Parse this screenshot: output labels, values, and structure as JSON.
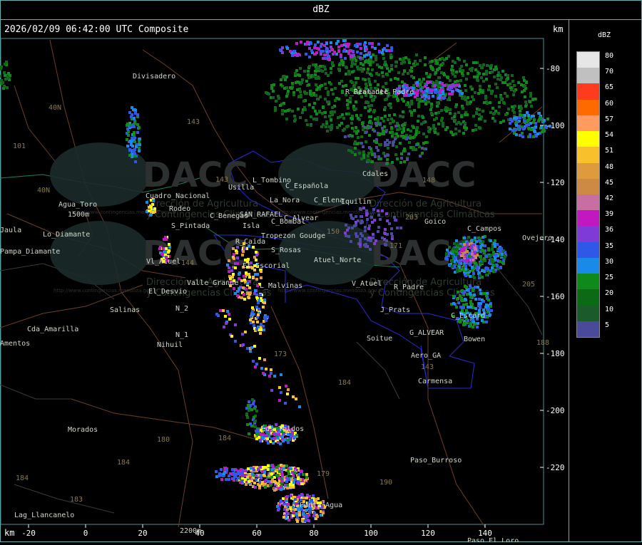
{
  "header": {
    "unit": "dBZ"
  },
  "map": {
    "timestamp": "2026/02/09 06:42:00 UTC Composite",
    "unit_top": "km",
    "unit_bottom": "km",
    "x_ticks": [
      "-20",
      "0",
      "20",
      "40",
      "60",
      "80",
      "100",
      "120",
      "140"
    ],
    "y_ticks": [
      "-80",
      "-100",
      "-120",
      "-140",
      "-160",
      "-180",
      "-200",
      "-220"
    ],
    "watermark": {
      "brand": "DACC",
      "line1": "Dirección de Agricultura",
      "line2": "y Contingencias Climáticas",
      "url": "http://www.contingencias.mendoza.gov.ar"
    },
    "places": [
      "Divisadero",
      "R_Diamante",
      "Agua_Toro",
      "1500m",
      "Lo_Diamante",
      "Pampa_Diamante",
      "Rodeo",
      "Cuadro_Nacional",
      "Vl_Atuel",
      "S_Pintada",
      "Usilla",
      "L_Tombino",
      "C_Española",
      "La_Nora",
      "C_Elena",
      "Iquilin",
      "Isla",
      "C_Benegas",
      "SAN_RAFAEL",
      "C_Alvear",
      "C_Bombal",
      "Goudge",
      "Tropezon",
      "R_Caida",
      "S_Rosas",
      "Atuel_Norte",
      "El_Escorial",
      "Valle_Grande",
      "L_Malvinas",
      "V_Atuel",
      "R_Padre",
      "El_Desvio",
      "Salinas",
      "N_2",
      "N_1",
      "Nihuil",
      "Cda_Amarilla",
      "Los_Toldos",
      "Punta_Agua",
      "Morados",
      "Lag_Llancanelo",
      "2200m",
      "Soitue",
      "G_ALVEAR",
      "Aero_GA",
      "Carmensa",
      "Paso_Burroso",
      "Paso_El_Loro",
      "Goico",
      "C_Campos",
      "C_Escard",
      "Bowen",
      "Ovejero",
      "J_Prats",
      "Cdales",
      "Real_del_Padre",
      "Jaula",
      "Amentos"
    ],
    "route_numbers": [
      "40N",
      "40N",
      "101",
      "143",
      "143",
      "144",
      "173",
      "179",
      "180",
      "184",
      "184",
      "183",
      "190",
      "188",
      "203",
      "205",
      "143",
      "148",
      "171",
      "184",
      "150",
      "184"
    ]
  },
  "legend": {
    "title": "dBZ",
    "items": [
      {
        "label": "80",
        "color": "#e6e6e6"
      },
      {
        "label": "70",
        "color": "#c0c0c0"
      },
      {
        "label": "65",
        "color": "#ff3b1f"
      },
      {
        "label": "60",
        "color": "#ff6a00"
      },
      {
        "label": "57",
        "color": "#ff9b5e"
      },
      {
        "label": "54",
        "color": "#ffff00"
      },
      {
        "label": "51",
        "color": "#f8c02a"
      },
      {
        "label": "48",
        "color": "#e09a3e"
      },
      {
        "label": "45",
        "color": "#cc8a44"
      },
      {
        "label": "42",
        "color": "#c86ea0"
      },
      {
        "label": "39",
        "color": "#c218c0"
      },
      {
        "label": "36",
        "color": "#7e3bd6"
      },
      {
        "label": "35",
        "color": "#2f57e8"
      },
      {
        "label": "30",
        "color": "#1a8ae8"
      },
      {
        "label": "25",
        "color": "#0f8a1a"
      },
      {
        "label": "20",
        "color": "#0b6b14"
      },
      {
        "label": "10",
        "color": "#1b5a2a"
      },
      {
        "label": "5",
        "color": "#4a4a9a"
      }
    ]
  }
}
